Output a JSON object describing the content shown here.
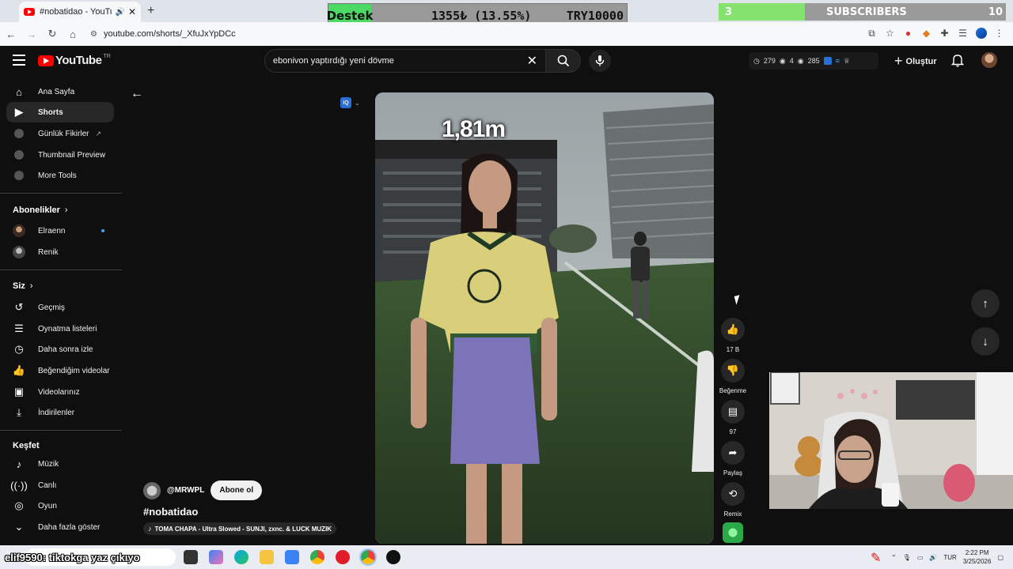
{
  "browser": {
    "tab_title": "#nobatidao - YouTube",
    "url": "youtube.com/shorts/_XfuJxYpDCc"
  },
  "donation_widget": {
    "label": "Destek",
    "amount": "1355₺ (13.55%)",
    "goal": "TRY10000",
    "progress_percent": 13.55,
    "accent": "#4cd964"
  },
  "subscriber_widget": {
    "current": "3",
    "label": "SUBSCRIBERS",
    "goal": "10",
    "progress_fraction": 0.3,
    "accent": "#86e26e"
  },
  "header": {
    "logo_text": "YouTube",
    "region": "TR",
    "search_value": "ebonivon yaptırdığı yeni dövme",
    "stats": {
      "a": "279",
      "b": "4",
      "c": "285"
    },
    "create_label": "Oluştur"
  },
  "sidebar": {
    "main": [
      {
        "label": "Ana Sayfa",
        "icon": "home-icon"
      },
      {
        "label": "Shorts",
        "icon": "shorts-icon",
        "active": true
      },
      {
        "label": "Günlük Fikirler",
        "icon": "tool-icon",
        "external": true
      },
      {
        "label": "Thumbnail Preview",
        "icon": "tool-icon"
      },
      {
        "label": "More Tools",
        "icon": "tool-icon"
      }
    ],
    "subscriptions_title": "Abonelikler",
    "subscriptions": [
      {
        "label": "Elraenn",
        "live_dot": true
      },
      {
        "label": "Renik"
      }
    ],
    "you_title": "Siz",
    "you": [
      {
        "label": "Geçmiş",
        "icon": "history-icon"
      },
      {
        "label": "Oynatma listeleri",
        "icon": "playlist-icon"
      },
      {
        "label": "Daha sonra izle",
        "icon": "clock-icon"
      },
      {
        "label": "Beğendiğim videolar",
        "icon": "like-icon"
      },
      {
        "label": "Videolarınız",
        "icon": "video-icon"
      },
      {
        "label": "İndirilenler",
        "icon": "download-icon"
      }
    ],
    "explore_title": "Keşfet",
    "explore": [
      {
        "label": "Müzik",
        "icon": "music-icon"
      },
      {
        "label": "Canlı",
        "icon": "live-icon"
      },
      {
        "label": "Oyun",
        "icon": "gaming-icon"
      },
      {
        "label": "Daha fazla göster",
        "icon": "chevron-down-icon"
      }
    ]
  },
  "short": {
    "overlay_text": "1,81m",
    "channel": "@MRWPL",
    "subscribe_label": "Abone ol",
    "title": "#nobatidao",
    "music": "TOMA CHAPA - Ultra Slowed - SUNJI, zxnc. & LUCK MUZIK",
    "actions": {
      "likes": "17 B",
      "dislike": "Beğenme",
      "comments": "97",
      "share": "Paylaş",
      "remix": "Remix"
    }
  },
  "taskbar": {
    "overlay_text": "elif9590: tiktokga yaz çıkıyo",
    "lang": "TUR",
    "time": "2:22 PM",
    "date": "3/25/2026"
  }
}
